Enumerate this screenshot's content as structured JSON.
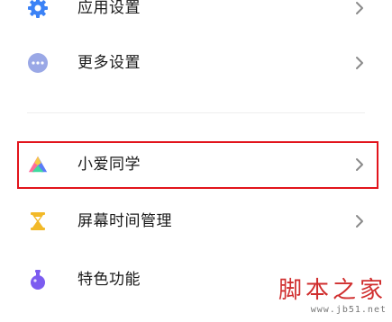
{
  "settings": {
    "items": [
      {
        "label": "应用设置",
        "icon": "gear-icon",
        "icon_color": "#3b82f6"
      },
      {
        "label": "更多设置",
        "icon": "more-dots-icon",
        "icon_color": "#9aa8e6"
      },
      {
        "label": "小爱同学",
        "icon": "xiaoai-icon",
        "highlighted": true,
        "highlight_color": "#e2141c"
      },
      {
        "label": "屏幕时间管理",
        "icon": "hourglass-icon",
        "icon_color": "#f2b928"
      },
      {
        "label": "特色功能",
        "icon": "flask-icon",
        "icon_color": "#7c5cf0"
      }
    ],
    "chevron_icon": "chevron-right-icon"
  },
  "watermark": {
    "title": "脚本之家",
    "url": "www.jb51.net"
  }
}
